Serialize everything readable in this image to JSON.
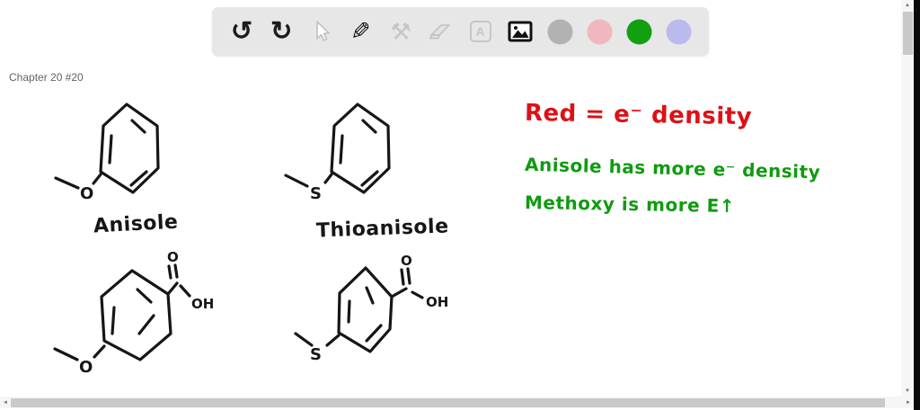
{
  "canvas": {
    "header": "Chapter 20 #20",
    "ink_color": "#161616",
    "labels": {
      "anisole": "Anisole",
      "thioanisole": "Thioanisole"
    },
    "atoms": {
      "oxygen": "O",
      "sulfur": "S",
      "hydroxyl": "OH"
    },
    "annotations": {
      "red_note": {
        "text": "Red = e⁻ density",
        "color": "#dd1116"
      },
      "green_note_1": {
        "text": "Anisole has more e⁻ density",
        "color": "#0f9b0f"
      },
      "green_note_2": {
        "text": "Methoxy is more E↑",
        "color": "#0f9b0f"
      }
    }
  },
  "toolbar": {
    "background": "#e7e7e7",
    "buttons": [
      {
        "id": "undo",
        "glyph": "↺",
        "enabled": true
      },
      {
        "id": "redo",
        "glyph": "↻",
        "enabled": true
      },
      {
        "id": "select",
        "enabled": false
      },
      {
        "id": "pen",
        "glyph": "✎",
        "enabled": true
      },
      {
        "id": "utilities",
        "glyph": "⚒",
        "enabled": false
      },
      {
        "id": "eraser",
        "enabled": false
      },
      {
        "id": "text",
        "glyph": "A",
        "enabled": false
      },
      {
        "id": "image",
        "enabled": true
      }
    ],
    "colors": [
      {
        "id": "gray",
        "hex": "#b2b2b2"
      },
      {
        "id": "pink",
        "hex": "#f1b7be"
      },
      {
        "id": "green",
        "hex": "#12a012"
      },
      {
        "id": "lavender",
        "hex": "#babaec"
      }
    ]
  },
  "scrollbars": {
    "up_arrow": "▲",
    "down_arrow": "▼",
    "left_arrow": "◄",
    "right_arrow": "►"
  }
}
